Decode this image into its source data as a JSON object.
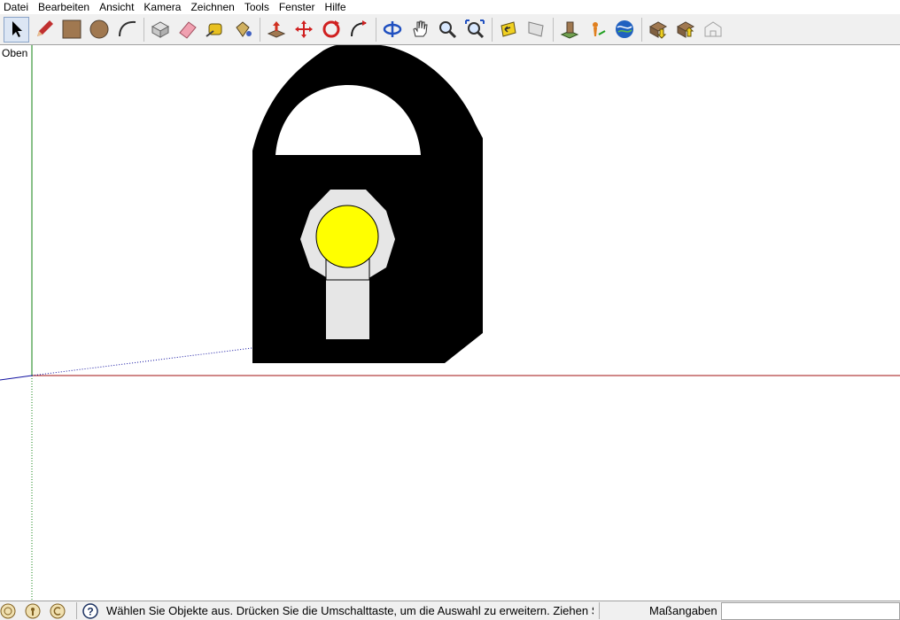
{
  "menu": {
    "items": [
      "Datei",
      "Bearbeiten",
      "Ansicht",
      "Kamera",
      "Zeichnen",
      "Tools",
      "Fenster",
      "Hilfe"
    ]
  },
  "toolbar": {
    "tools": [
      {
        "name": "select-tool-icon",
        "active": true
      },
      {
        "name": "pencil-tool-icon"
      },
      {
        "name": "rectangle-tool-icon"
      },
      {
        "name": "circle-tool-icon"
      },
      {
        "name": "arc-tool-icon"
      },
      {
        "name": "make-component-icon",
        "sep_before": true
      },
      {
        "name": "eraser-tool-icon"
      },
      {
        "name": "tape-measure-icon"
      },
      {
        "name": "paint-bucket-icon"
      },
      {
        "name": "push-pull-icon",
        "sep_before": true
      },
      {
        "name": "move-tool-icon"
      },
      {
        "name": "rotate-tool-icon"
      },
      {
        "name": "follow-me-icon"
      },
      {
        "name": "orbit-icon",
        "sep_before": true
      },
      {
        "name": "pan-icon"
      },
      {
        "name": "zoom-icon"
      },
      {
        "name": "zoom-extents-icon"
      },
      {
        "name": "previous-view-icon",
        "sep_before": true
      },
      {
        "name": "next-view-icon"
      },
      {
        "name": "get-models-icon",
        "sep_before": true
      },
      {
        "name": "get-current-view-icon"
      },
      {
        "name": "toggle-terrain-icon"
      },
      {
        "name": "share-model-icon",
        "sep_before": true
      },
      {
        "name": "share-component-icon"
      },
      {
        "name": "3d-warehouse-icon"
      }
    ]
  },
  "viewport": {
    "view_name": "Oben"
  },
  "scene": {
    "axis_colors": {
      "red": "#a01010",
      "green": "#108010",
      "blue": "#1010a0"
    },
    "lock_body_color": "#000000",
    "keyhole_ring_color": "#e6e6e6",
    "keyhole_center_color": "#ffff00",
    "keyhole_slot_color": "#e6e6e6"
  },
  "status": {
    "icons": [
      "geo-location-icon",
      "credits-icon",
      "sign-in-icon"
    ],
    "help_icon": "help-icon",
    "message": "Wählen Sie Objekte aus. Drücken Sie die Umschalttaste, um die Auswahl zu erweitern. Ziehen S",
    "measure_label": "Maßangaben",
    "measure_value": ""
  }
}
